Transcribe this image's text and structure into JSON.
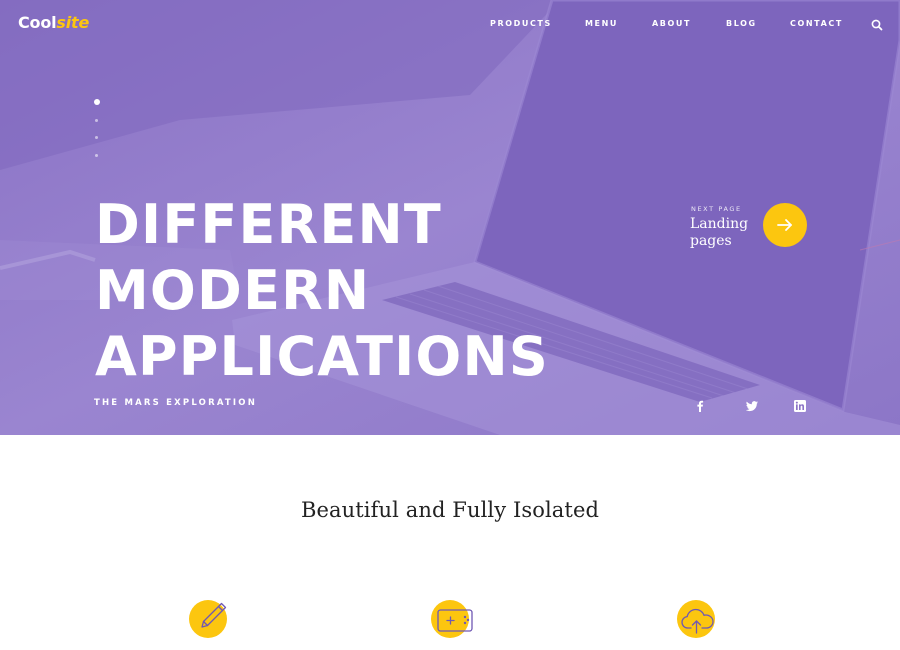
{
  "logo": {
    "text_main": "Cool",
    "text_accent": "site"
  },
  "nav": {
    "items": [
      {
        "label": "PRODUCTS"
      },
      {
        "label": "MENU"
      },
      {
        "label": "ABOUT"
      },
      {
        "label": "BLOG"
      },
      {
        "label": "CONTACT"
      }
    ],
    "search_icon": "search-icon"
  },
  "slider": {
    "total_slides": 4,
    "active_slide": 1
  },
  "hero": {
    "headline": [
      "DIFFERENT",
      "MODERN",
      "APPLICATIONS"
    ],
    "subtitle": "THE MARS EXPLORATION"
  },
  "next_page": {
    "label": "NEXT PAGE",
    "title_line1": "Landing",
    "title_line2": "pages",
    "icon": "arrow-right-icon"
  },
  "social": [
    {
      "name": "facebook",
      "icon": "facebook-icon"
    },
    {
      "name": "twitter",
      "icon": "twitter-icon"
    },
    {
      "name": "linkedin",
      "icon": "linkedin-icon"
    }
  ],
  "section": {
    "title": "Beautiful and Fully Isolated",
    "features": [
      {
        "icon": "pencil-icon"
      },
      {
        "icon": "gamepad-icon"
      },
      {
        "icon": "cloud-upload-icon"
      }
    ]
  },
  "colors": {
    "hero_overlay": "#8c74c6",
    "accent": "#fcc60f",
    "icon_stroke": "#6f58b3",
    "text_dark": "#222222"
  }
}
